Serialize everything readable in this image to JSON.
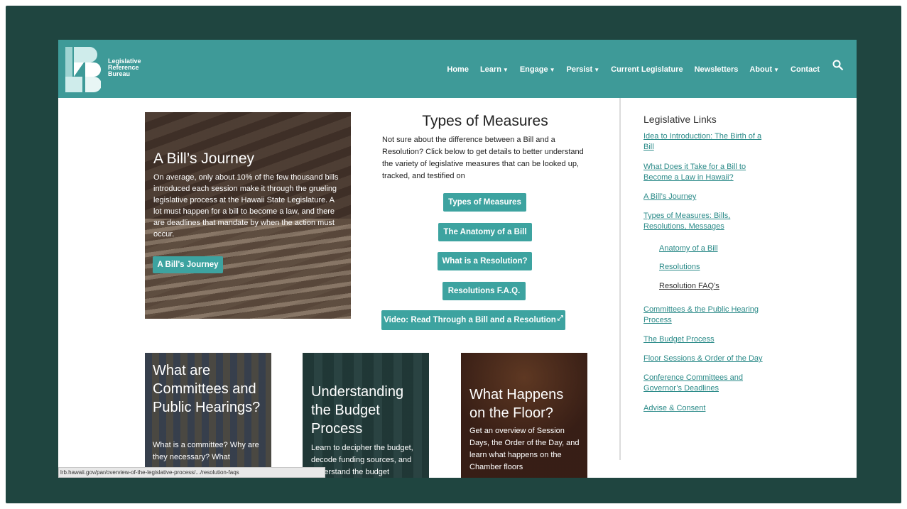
{
  "header": {
    "logo_line1": "Legislative",
    "logo_line2": "Reference",
    "logo_line3": "Bureau",
    "nav": [
      {
        "label": "Home",
        "caret": false
      },
      {
        "label": "Learn",
        "caret": true
      },
      {
        "label": "Engage",
        "caret": true
      },
      {
        "label": "Persist",
        "caret": true
      },
      {
        "label": "Current Legislature",
        "caret": false
      },
      {
        "label": "Newsletters",
        "caret": false
      },
      {
        "label": "About",
        "caret": true
      },
      {
        "label": "Contact",
        "caret": false
      }
    ],
    "search_icon": "search-icon"
  },
  "hero": {
    "title": "A Bill’s Journey",
    "text": "On average, only about 10% of the few thousand bills introduced each session make it through the grueling legislative process at the Hawaii State Legislature. A lot must happen for a bill to become a law, and there are deadlines that mandate by when the action must occur.",
    "button": "A Bill's Journey"
  },
  "measures": {
    "title": "Types of Measures",
    "text": "Not sure about the difference between a Bill and a Resolution? Click below to get details to better understand the variety of legislative measures that can be looked up, tracked, and testified on",
    "buttons": [
      "Types of Measures",
      "The Anatomy of a Bill",
      "What is a Resolution?",
      "Resolutions F.A.Q.",
      "Video: Read Through a Bill and a Resolution"
    ]
  },
  "sidebar": {
    "title": "Legislative Links",
    "links": [
      "Idea to Introduction: The Birth of a Bill",
      "What Does it Take for a Bill to Become a Law in Hawaii?",
      "A Bill’s Journey",
      "Types of Measures: Bills, Resolutions, Messages",
      "Anatomy of a Bill",
      "Resolutions",
      "Resolution FAQ’s",
      "Committees & the Public Hearing Process",
      "The Budget Process",
      "Floor Sessions & Order of the Day",
      "Conference Committees and Governor’s Deadlines",
      "Advise & Consent"
    ]
  },
  "cards": [
    {
      "title": "What are Committees and Public Hearings?",
      "text": "What is a committee? Why are they necessary? What"
    },
    {
      "title": "Understanding the Budget Process",
      "text": "Learn to decipher the budget, decode funding sources, and understand the budget"
    },
    {
      "title": "What Happens on the Floor?",
      "text": "Get an overview of Session Days, the Order of the Day, and learn what happens on the Chamber floors"
    }
  ],
  "status_url": "lrb.hawaii.gov/par/overview-of-the-legislative-process/.../resolution-faqs",
  "colors": {
    "teal": "#3e9a98",
    "button": "#3da3a0",
    "link": "#2a8a88",
    "frame": "#1f4540"
  }
}
